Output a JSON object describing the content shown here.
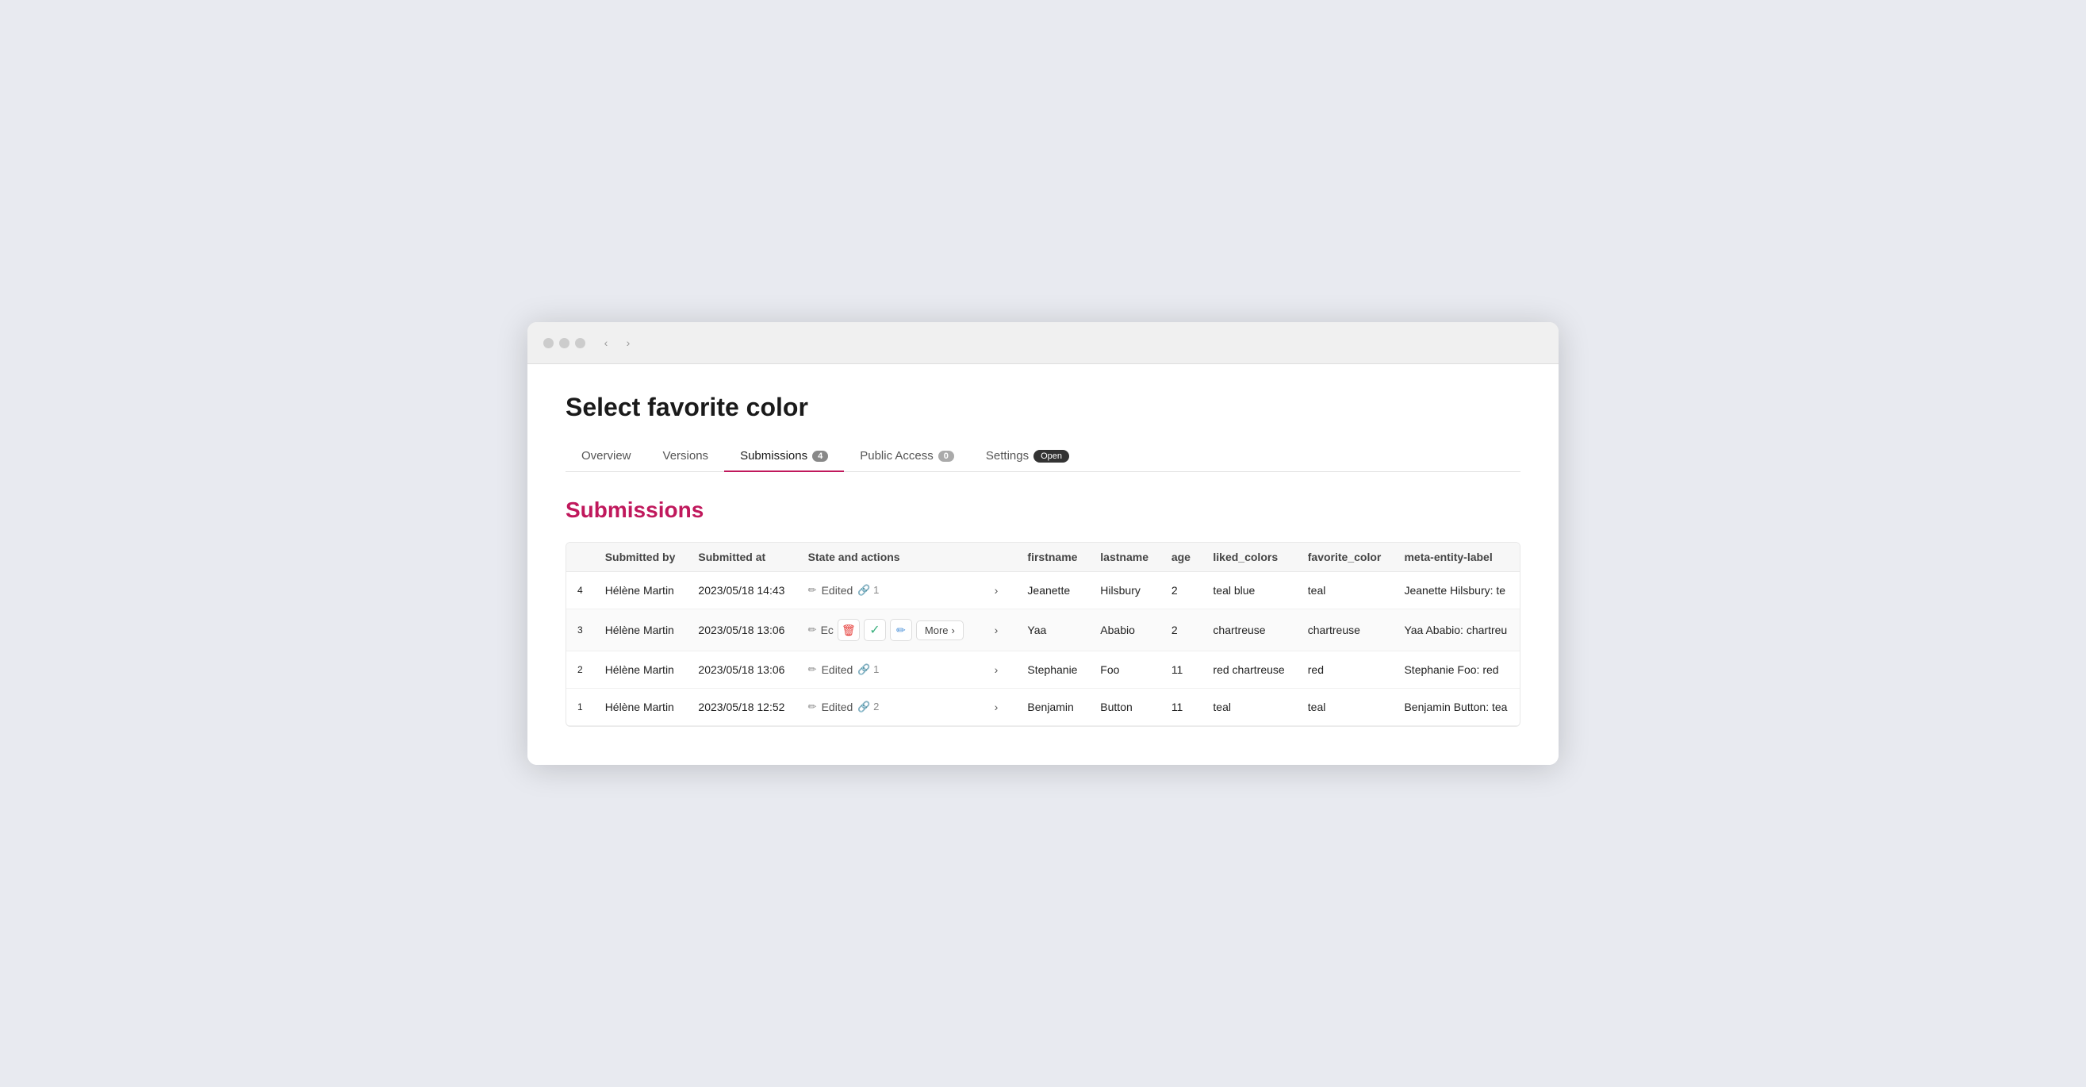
{
  "browser": {
    "dots": [
      "dot1",
      "dot2",
      "dot3"
    ],
    "nav": {
      "back": "‹",
      "forward": "›"
    }
  },
  "page": {
    "title": "Select favorite color"
  },
  "tabs": [
    {
      "id": "overview",
      "label": "Overview",
      "badge": null,
      "active": false
    },
    {
      "id": "versions",
      "label": "Versions",
      "badge": null,
      "active": false
    },
    {
      "id": "submissions",
      "label": "Submissions",
      "badge": "4",
      "active": true
    },
    {
      "id": "public-access",
      "label": "Public Access",
      "badge": "0",
      "active": false
    },
    {
      "id": "settings",
      "label": "Settings",
      "status": "Open",
      "active": false
    }
  ],
  "section": {
    "title": "Submissions"
  },
  "table": {
    "columns": [
      {
        "id": "row-num",
        "label": ""
      },
      {
        "id": "submitted-by",
        "label": "Submitted by"
      },
      {
        "id": "submitted-at",
        "label": "Submitted at"
      },
      {
        "id": "state-actions",
        "label": "State and actions"
      },
      {
        "id": "firstname",
        "label": "firstname"
      },
      {
        "id": "lastname",
        "label": "lastname"
      },
      {
        "id": "age",
        "label": "age"
      },
      {
        "id": "liked-colors",
        "label": "liked_colors"
      },
      {
        "id": "favorite-color",
        "label": "favorite_color"
      },
      {
        "id": "meta-entity-label",
        "label": "meta-entity-label"
      }
    ],
    "rows": [
      {
        "rowNum": "4",
        "submittedBy": "Hélène Martin",
        "submittedAt": "2023/05/18 14:43",
        "state": "Edited",
        "linkCount": "1",
        "firstname": "Jeanette",
        "lastname": "Hilsbury",
        "age": "2",
        "likedColors": "teal blue",
        "favoriteColor": "teal",
        "metaEntityLabel": "Jeanette Hilsbury: te",
        "highlighted": false,
        "showActionBar": false
      },
      {
        "rowNum": "3",
        "submittedBy": "Hélène Martin",
        "submittedAt": "2023/05/18 13:06",
        "state": "Ec",
        "linkCount": null,
        "firstname": "Yaa",
        "lastname": "Ababio",
        "age": "2",
        "likedColors": "chartreuse",
        "favoriteColor": "chartreuse",
        "metaEntityLabel": "Yaa Ababio: chartreu",
        "highlighted": true,
        "showActionBar": true
      },
      {
        "rowNum": "2",
        "submittedBy": "Hélène Martin",
        "submittedAt": "2023/05/18 13:06",
        "state": "Edited",
        "linkCount": "1",
        "firstname": "Stephanie",
        "lastname": "Foo",
        "age": "11",
        "likedColors": "red chartreuse",
        "favoriteColor": "red",
        "metaEntityLabel": "Stephanie Foo: red",
        "highlighted": false,
        "showActionBar": false
      },
      {
        "rowNum": "1",
        "submittedBy": "Hélène Martin",
        "submittedAt": "2023/05/18 12:52",
        "state": "Edited",
        "linkCount": "2",
        "firstname": "Benjamin",
        "lastname": "Button",
        "age": "11",
        "likedColors": "teal",
        "favoriteColor": "teal",
        "metaEntityLabel": "Benjamin Button: tea",
        "highlighted": false,
        "showActionBar": false
      }
    ],
    "actions": {
      "editIcon": "✏️",
      "deleteIcon": "🗑",
      "checkIcon": "✓",
      "pencilBlueIcon": "✏",
      "moreLabel": "More",
      "chevronRight": "›"
    }
  }
}
